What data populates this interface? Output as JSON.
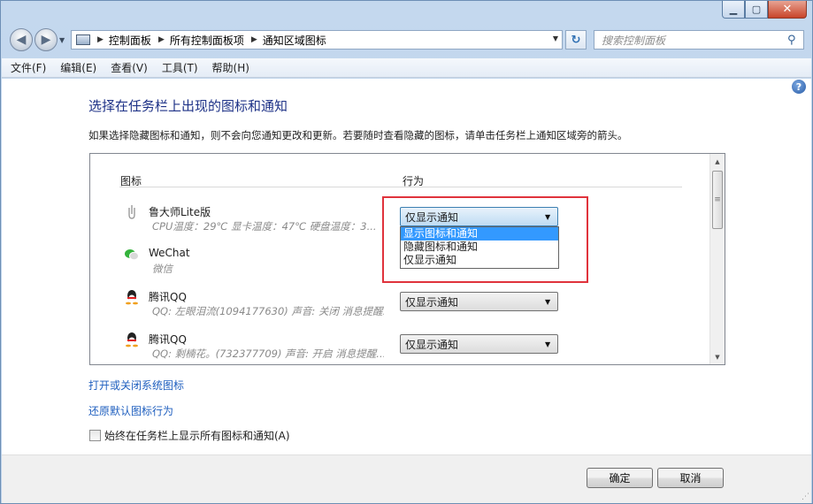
{
  "window": {
    "min_glyph": "▁",
    "max_glyph": "▢",
    "close_glyph": "✕"
  },
  "nav": {
    "back_glyph": "◀",
    "forward_glyph": "▶",
    "breadcrumb": [
      "控制面板",
      "所有控制面板项",
      "通知区域图标"
    ],
    "search_placeholder": "搜索控制面板",
    "refresh_glyph": "↻"
  },
  "menu": [
    "文件(F)",
    "编辑(E)",
    "查看(V)",
    "工具(T)",
    "帮助(H)"
  ],
  "page": {
    "help_glyph": "?",
    "title": "选择在任务栏上出现的图标和通知",
    "description": "如果选择隐藏图标和通知，则不会向您通知更改和更新。若要随时查看隐藏的图标，请单击任务栏上通知区域旁的箭头。"
  },
  "table": {
    "col_icon": "图标",
    "col_behavior": "行为",
    "rows": [
      {
        "icon": "ludashi-icon",
        "name": "鲁大师Lite版",
        "sub": "CPU温度：29℃  显卡温度：47℃  硬盘温度：3...",
        "behavior": "仅显示通知"
      },
      {
        "icon": "wechat-icon",
        "name": "WeChat",
        "sub": "微信",
        "behavior": ""
      },
      {
        "icon": "qq-icon",
        "name": "腾讯QQ",
        "sub": "QQ: 左眼泪流(1094177630)  声音: 关闭  消息提醒...",
        "behavior": "仅显示通知"
      },
      {
        "icon": "qq-icon",
        "name": "腾讯QQ",
        "sub": "QQ: 剩楠花。(732377709)  声音: 开启  消息提醒...",
        "behavior": "仅显示通知"
      }
    ],
    "dropdown_options": [
      "显示图标和通知",
      "隐藏图标和通知",
      "仅显示通知"
    ]
  },
  "links": {
    "system_icons": "打开或关闭系统图标",
    "restore": "还原默认图标行为"
  },
  "always_show": "始终在任务栏上显示所有图标和通知(A)",
  "buttons": {
    "ok": "确定",
    "cancel": "取消"
  },
  "colors": {
    "title": "#1e3287",
    "link": "#1f5fbf",
    "highlight_box": "#e0333c",
    "selected": "#3399ff"
  }
}
